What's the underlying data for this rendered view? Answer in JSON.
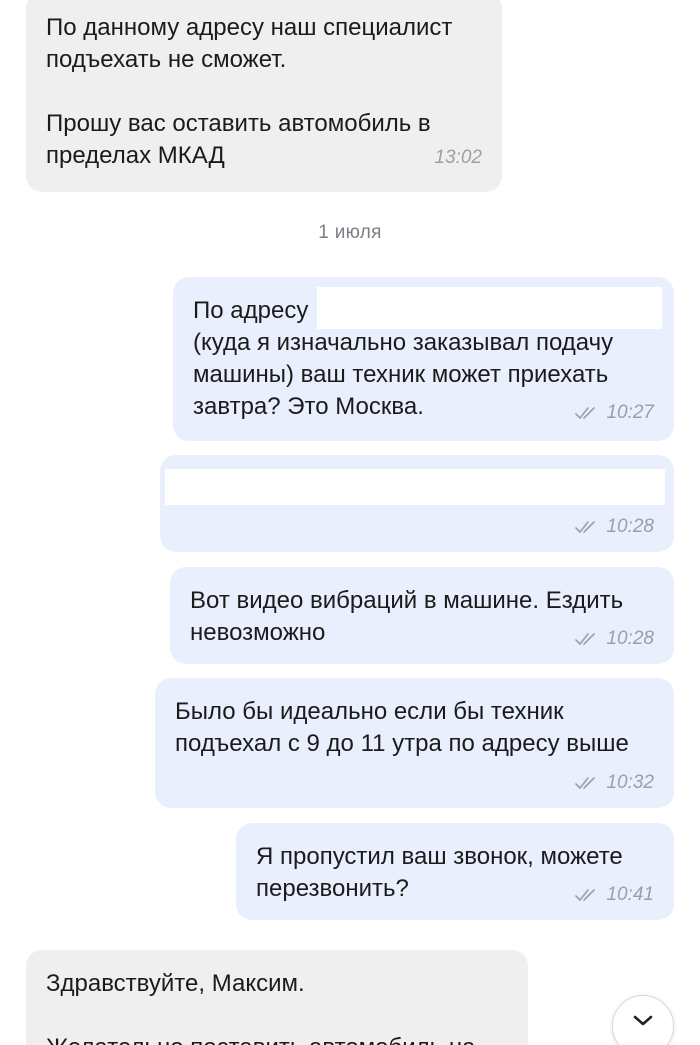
{
  "chat": {
    "date_separator": "1 июля",
    "messages": [
      {
        "direction": "incoming",
        "text": "По данному адресу наш специалист\nподъехать не сможет.\n\nПрошу вас оставить автомобиль в\nпределах МКАД",
        "time": "13:02"
      },
      {
        "direction": "outgoing",
        "text": "По адресу \n(куда я изначально заказывал подачу\nмашины) ваш техник может приехать\nзавтра? Это Москва.",
        "time": "10:27",
        "status": "read"
      },
      {
        "direction": "outgoing",
        "text": "",
        "time": "10:28",
        "status": "read"
      },
      {
        "direction": "outgoing",
        "text": "Вот видео вибраций в машине. Ездить\nневозможно",
        "time": "10:28",
        "status": "read"
      },
      {
        "direction": "outgoing",
        "text": "Было бы идеально если бы техник\nподъехал с 9 до 11 утра по адресу выше",
        "time": "10:32",
        "status": "read"
      },
      {
        "direction": "outgoing",
        "text": "Я пропустил ваш звонок, можете\nперезвонить?",
        "time": "10:41",
        "status": "read"
      },
      {
        "direction": "incoming",
        "text": "Здравствуйте, Максим.\n\nЖелательно поставить автомобиль на",
        "time": ""
      }
    ]
  },
  "icons": {
    "read_receipt": "double-check-icon",
    "scroll_down": "chevron-down-icon"
  },
  "colors": {
    "incoming_bubble": "#efefef",
    "outgoing_bubble": "#e9effd",
    "timestamp": "#9aa0a8"
  }
}
